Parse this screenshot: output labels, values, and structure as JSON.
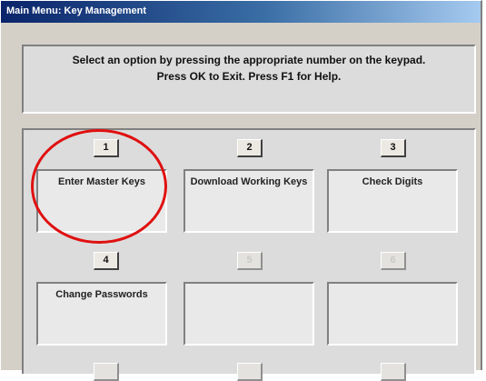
{
  "window": {
    "title": "Main Menu: Key Management"
  },
  "instructions": {
    "line1": "Select an option by pressing the appropriate number on the keypad.",
    "line2": "Press OK to Exit.  Press F1 for Help."
  },
  "options": [
    {
      "number": "1",
      "label": "Enter Master Keys",
      "enabled": true
    },
    {
      "number": "2",
      "label": "Download Working Keys",
      "enabled": true
    },
    {
      "number": "3",
      "label": "Check Digits",
      "enabled": true
    },
    {
      "number": "4",
      "label": "Change Passwords",
      "enabled": true
    },
    {
      "number": "5",
      "label": "",
      "enabled": false
    },
    {
      "number": "6",
      "label": "",
      "enabled": false
    }
  ],
  "annotation": {
    "shape": "circle",
    "color": "#e01010",
    "target": "option-1"
  }
}
